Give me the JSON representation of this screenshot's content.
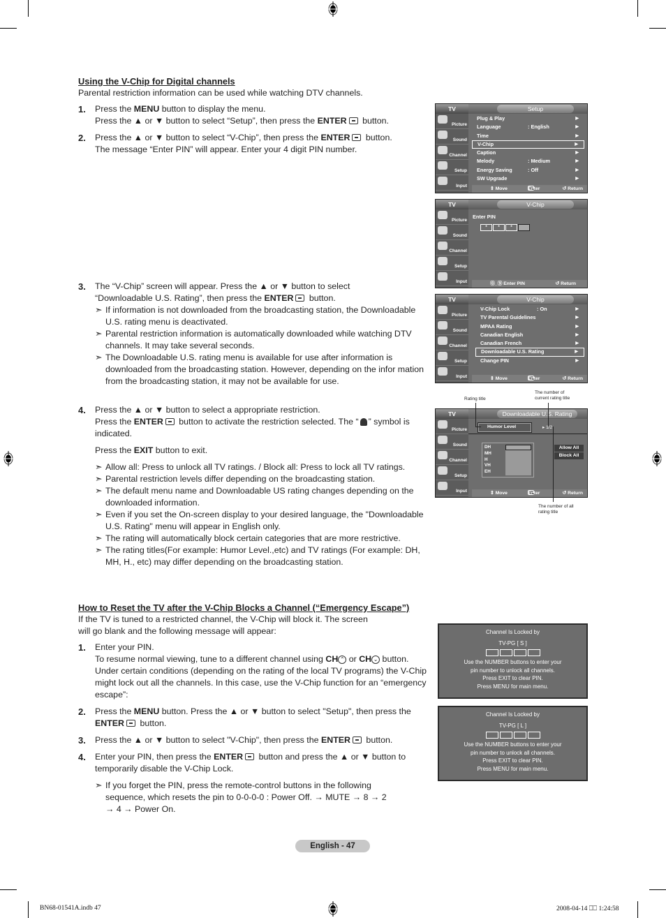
{
  "section1": {
    "heading": "Using the V-Chip for Digital channels",
    "intro": "Parental restriction information can be used while watching DTV channels.",
    "steps": [
      {
        "num": "1.",
        "line1_pre": "Press the ",
        "line1_bold": "MENU",
        "line1_post": " button to display the menu.",
        "line2_pre": "Press the ▲ or ▼ button to select “Setup”, then press the ",
        "line2_bold": "ENTER",
        "line2_post": " button."
      },
      {
        "num": "2.",
        "line1_pre": "Press the ▲ or ▼ button to select “V-Chip”, then press the ",
        "line1_bold": "ENTER",
        "line1_post": " button.",
        "line2": "The message “Enter PIN” will appear. Enter your 4 digit PIN number."
      },
      {
        "num": "3.",
        "line1": "The “V-Chip” screen will appear. Press the ▲ or ▼ button to select",
        "line2_pre": "“Downloadable U.S. Rating”, then press the ",
        "line2_bold": "ENTER",
        "line2_post": " button.",
        "notes": [
          "If information is not downloaded from the broadcasting station, the Downloadable U.S. rating menu is deactivated.",
          "Parental restriction information is automatically downloaded while watching DTV channels. It may take several seconds.",
          "The Downloadable U.S. rating menu is available for use after information is downloaded from the broadcasting station. However, depending on the infor mation from the broadcasting station, it may not be available for use."
        ]
      },
      {
        "num": "4.",
        "line1": "Press the ▲ or ▼ button to select a appropriate restriction.",
        "line2_pre": "Press the ",
        "line2_bold": "ENTER",
        "line2_mid": " button to activate the restriction selected. The “",
        "line2_post": "” symbol is indicated.",
        "exit_pre": "Press the ",
        "exit_bold": "EXIT",
        "exit_post": " button to exit.",
        "notes": [
          "Allow all: Press to unlock all TV ratings. / Block all: Press to lock all TV ratings.",
          "Parental restriction levels differ depending on the broadcasting station.",
          "The default menu name and Downloadable US rating changes depending on the downloaded information.",
          "Even if you set the On-screen display to your desired language, the \"Downloadable U.S. Rating\" menu will appear in English only.",
          "The rating will automatically block certain categories that are more restrictive.",
          "The rating titles(For example: Humor Level.,etc) and TV ratings (For example: DH, MH, H., etc) may differ depending on the broadcasting station."
        ]
      }
    ]
  },
  "section2": {
    "heading": "How to Reset the TV after the V-Chip Blocks a Channel (“Emergency Escape”)",
    "intro": "If the TV is tuned to a restricted channel, the V-Chip will block it. The screen will go blank and the following message will appear:",
    "step1": {
      "num": "1.",
      "line1": "Enter your PIN.",
      "p1": "To resume normal viewing, tune to a different channel using ",
      "ch": "CH",
      "or": " or ",
      "p2": " button. Under certain conditions (depending on the rating of the local TV programs) the V-Chip might lock out all the channels. In this case, use the V-Chip function for an “emergency escape”:"
    },
    "step2": {
      "num": "2.",
      "pre": "Press the ",
      "bold1": "MENU",
      "mid": " button. Press the ▲ or ▼ button to select \"Setup\", then press the ",
      "bold2": "ENTER",
      "post": " button."
    },
    "step3": {
      "num": "3.",
      "pre": "Press the ▲ or ▼ button to select \"V-Chip\", then press the ",
      "bold": "ENTER",
      "post": " button."
    },
    "step4": {
      "num": "4.",
      "pre": "Enter your PIN, then press the ",
      "bold": "ENTER",
      "post": " button and press the ▲ or ▼ button to temporarily disable the V-Chip Lock."
    },
    "note": "If you forget the PIN, press the remote-control buttons in the following sequence, which resets the pin to 0-0-0-0 : Power Off. → MUTE → 8 → 2 → 4 → Power On."
  },
  "osd_common": {
    "tv": "TV",
    "sidebar": [
      "Picture",
      "Sound",
      "Channel",
      "Setup",
      "Input"
    ],
    "foot_move": "⇕ Move",
    "foot_enter": "Enter",
    "foot_return": "↺ Return"
  },
  "osd_setup": {
    "title": "Setup",
    "items": [
      {
        "label": "Plug & Play",
        "value": ""
      },
      {
        "label": "Language",
        "value": ": English"
      },
      {
        "label": "Time",
        "value": ""
      },
      {
        "label": "V-Chip",
        "value": "",
        "selected": true
      },
      {
        "label": "Caption",
        "value": ""
      },
      {
        "label": "Melody",
        "value": ": Medium"
      },
      {
        "label": "Energy Saving",
        "value": ": Off"
      },
      {
        "label": "SW Upgrade",
        "value": ""
      }
    ]
  },
  "osd_pin": {
    "title": "V-Chip",
    "label": "Enter PIN",
    "pin_mask": [
      "*",
      "*",
      "*",
      ""
    ],
    "foot_enter_pin": "⓪_⑨ Enter PIN",
    "foot_return": "↺ Return"
  },
  "osd_vchip": {
    "title": "V-Chip",
    "items": [
      {
        "label": "V-Chip Lock",
        "value": ": On"
      },
      {
        "label": "TV Parental Guidelines",
        "value": ""
      },
      {
        "label": "MPAA Rating",
        "value": ""
      },
      {
        "label": "Canadian English",
        "value": ""
      },
      {
        "label": "Canadian French",
        "value": ""
      },
      {
        "label": "Downloadable U.S. Rating",
        "value": "",
        "selected": true
      },
      {
        "label": "Change PIN",
        "value": ""
      }
    ]
  },
  "osd_download": {
    "title": "Downloadable U.S. Rating",
    "rating_title": "Humor Level",
    "counter": "▸ 1/2",
    "ratings": [
      "DH",
      "MH",
      "H",
      "VH",
      "EH"
    ],
    "allow_all": "Allow All",
    "block_all": "Block All",
    "anno_rating_title": "Rating title",
    "anno_current": "The number of current rating title",
    "anno_all": "The number of all rating title"
  },
  "lock_screens": [
    {
      "line1": "Channel Is Locked by",
      "rating": "TV-PG [ S ]",
      "msg": [
        "Use the NUMBER buttons to enter your",
        "pin number to unlock all channels.",
        "Press EXIT to clear PIN.",
        "Press MENU for main menu."
      ]
    },
    {
      "line1": "Channel Is Locked by",
      "rating": "TV-PG [ L ]",
      "msg": [
        "Use the NUMBER buttons to enter your",
        "pin number to unlock all channels.",
        "Press EXIT to clear PIN.",
        "Press MENU for main menu."
      ]
    }
  ],
  "footer": {
    "page_label": "English - 47",
    "slug_left": "BN68-01541A.indb   47",
    "slug_right": "2008-04-14   ⎕⎕ 1:24:58"
  }
}
